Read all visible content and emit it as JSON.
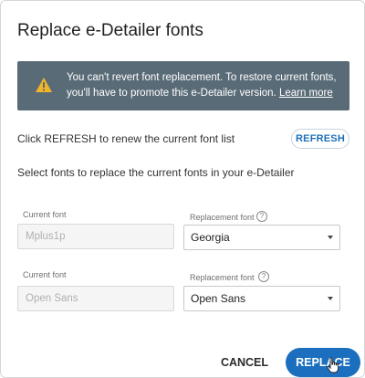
{
  "dialog": {
    "title": "Replace e-Detailer fonts",
    "alert": {
      "message": "You can't revert font replacement. To restore current fonts, you'll have to promote this e-Detailer version.",
      "link": "Learn more",
      "background": "#5a6b78",
      "icon": "warning-icon"
    },
    "refresh_instructions": "Click REFRESH to renew the current font list",
    "refresh_label": "REFRESH",
    "select_instructions": "Select fonts to replace the current fonts in your e-Detailer",
    "font_rows": [
      {
        "current_label": "Current font",
        "current_value": "Mplus1p",
        "replacement_label": "Replacement font",
        "replacement_value": "Georgia"
      },
      {
        "current_label": "Current font",
        "current_value": "Open Sans",
        "replacement_label": "Replacement font",
        "replacement_value": "Open Sans"
      }
    ],
    "cancel_label": "CANCEL",
    "replace_label": "REPLACE",
    "accent_color": "#1b6fbe"
  }
}
